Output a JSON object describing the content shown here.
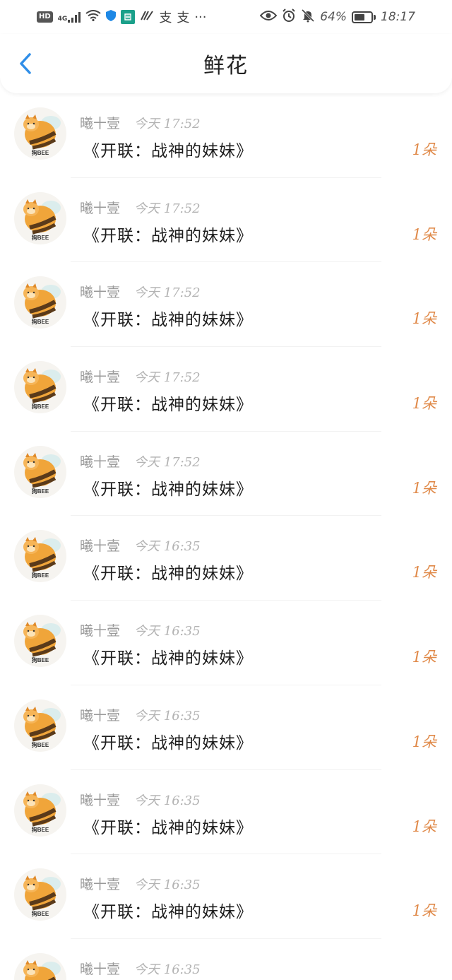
{
  "status_bar": {
    "hd": "HD",
    "network": "4G",
    "extra_a": "支",
    "extra_b": "支",
    "more": "···",
    "battery_percent": "64%",
    "battery_level": 0.64,
    "time": "18:17"
  },
  "header": {
    "title": "鲜花"
  },
  "items": [
    {
      "sender": "曦十壹",
      "time": "今天 17:52",
      "subject": "《开联：战神的妹妹》",
      "count": "1朵"
    },
    {
      "sender": "曦十壹",
      "time": "今天 17:52",
      "subject": "《开联：战神的妹妹》",
      "count": "1朵"
    },
    {
      "sender": "曦十壹",
      "time": "今天 17:52",
      "subject": "《开联：战神的妹妹》",
      "count": "1朵"
    },
    {
      "sender": "曦十壹",
      "time": "今天 17:52",
      "subject": "《开联：战神的妹妹》",
      "count": "1朵"
    },
    {
      "sender": "曦十壹",
      "time": "今天 17:52",
      "subject": "《开联：战神的妹妹》",
      "count": "1朵"
    },
    {
      "sender": "曦十壹",
      "time": "今天 16:35",
      "subject": "《开联：战神的妹妹》",
      "count": "1朵"
    },
    {
      "sender": "曦十壹",
      "time": "今天 16:35",
      "subject": "《开联：战神的妹妹》",
      "count": "1朵"
    },
    {
      "sender": "曦十壹",
      "time": "今天 16:35",
      "subject": "《开联：战神的妹妹》",
      "count": "1朵"
    },
    {
      "sender": "曦十壹",
      "time": "今天 16:35",
      "subject": "《开联：战神的妹妹》",
      "count": "1朵"
    },
    {
      "sender": "曦十壹",
      "time": "今天 16:35",
      "subject": "《开联：战神的妹妹》",
      "count": "1朵"
    },
    {
      "sender": "曦十壹",
      "time": "今天 16:35",
      "subject": "",
      "count": ""
    }
  ],
  "avatar": {
    "caption": "狗BEE",
    "icon": "bee-dog-avatar"
  },
  "colors": {
    "accent": "#2f8ee8",
    "count": "#e08a4a",
    "meta": "#9a9a9a"
  }
}
